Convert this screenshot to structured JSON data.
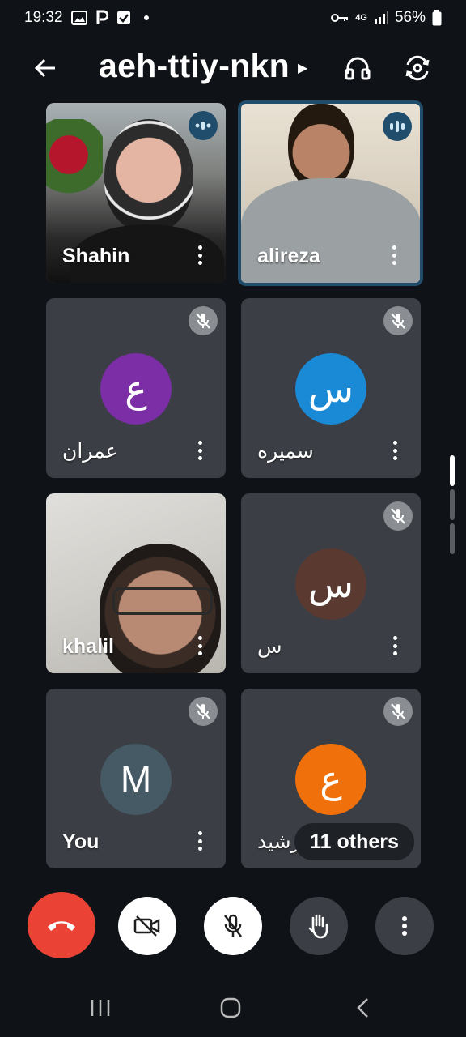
{
  "status_bar": {
    "time": "19:32",
    "network": "4G",
    "battery": "56%"
  },
  "header": {
    "meeting_code": "aeh-ttiy-nkn"
  },
  "tiles": [
    {
      "name": "Shahin",
      "state": "speaking",
      "video": true
    },
    {
      "name": "alireza",
      "state": "speaking",
      "video": true
    },
    {
      "name": "عمران",
      "avatar_letter": "ع",
      "avatar_color": "#7b2ea6",
      "muted": true
    },
    {
      "name": "سميره",
      "avatar_letter": "س",
      "avatar_color": "#1a8ad6",
      "muted": true
    },
    {
      "name": "khalil",
      "video": true
    },
    {
      "name": "س",
      "avatar_letter": "س",
      "avatar_color": "#5a3a30",
      "muted": true
    },
    {
      "name": "You",
      "avatar_letter": "M",
      "avatar_color": "#455a64",
      "muted": true
    },
    {
      "name": "الرشيد",
      "avatar_letter": "ع",
      "avatar_color": "#f0710b",
      "muted": true
    }
  ],
  "others_chip": "11 others",
  "controls": {
    "end_call_color": "#ea4335",
    "accent_speaking": "#1f4d6b"
  }
}
